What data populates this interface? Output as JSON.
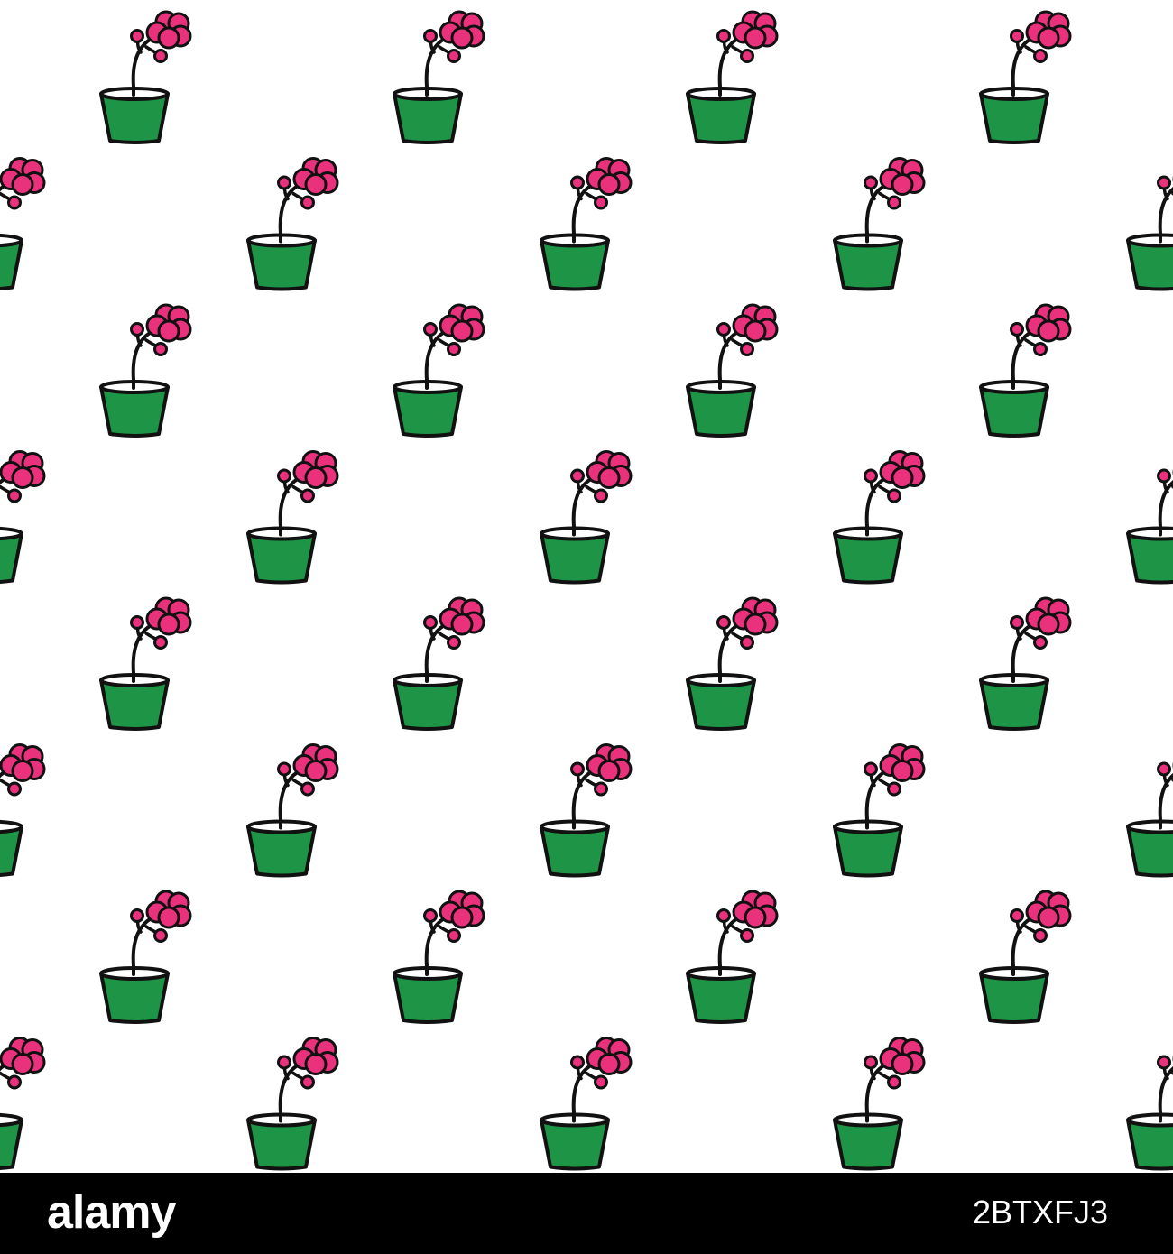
{
  "pattern": {
    "motif": "flowering-plant-in-pot-icon",
    "colors": {
      "background": "#ffffff",
      "pot": "#1e9447",
      "pot_rim_inner": "#ffffff",
      "flower": "#e9317c",
      "outline": "#111111"
    }
  },
  "footer": {
    "logo_text": "alamy",
    "image_id": "2BTXFJ3",
    "background": "#000000",
    "text_color": "#ffffff"
  }
}
